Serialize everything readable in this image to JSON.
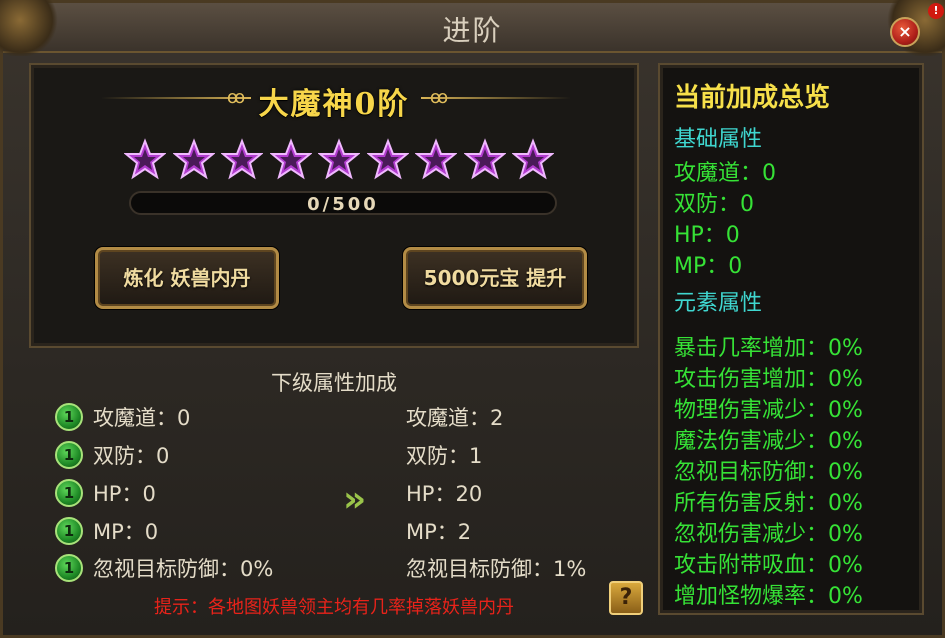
{
  "window": {
    "title": "进阶",
    "close_label": "×",
    "notif_badge": "!"
  },
  "rank": {
    "title": "大魔神0阶",
    "stars_total": 9,
    "stars_filled": 0,
    "progress_text": "0/500",
    "progress_fraction": 0
  },
  "buttons": {
    "refine": "炼化 妖兽内丹",
    "upgrade": "5000元宝 提升"
  },
  "next_level": {
    "title": "下级属性加成",
    "badge_label": "1",
    "current": [
      "攻魔道：0",
      "双防：0",
      "HP：0",
      "MP：0",
      "忽视目标防御：0%"
    ],
    "next": [
      "攻魔道：2",
      "双防：1",
      "HP：20",
      "MP：2",
      "忽视目标防御：1%"
    ],
    "arrow": "»"
  },
  "hint": "提示：各地图妖兽领主均有几率掉落妖兽内丹",
  "help_label": "?",
  "summary": {
    "title": "当前加成总览",
    "base_title": "基础属性",
    "base": [
      "攻魔道：0",
      "双防：0",
      "HP：0",
      "MP：0"
    ],
    "element_title": "元素属性",
    "element": [
      "暴击几率增加：0%",
      "攻击伤害增加：0%",
      "物理伤害减少：0%",
      "魔法伤害减少：0%",
      "忽视目标防御：0%",
      "所有伤害反射：0%",
      "忽视伤害减少：0%",
      "攻击附带吸血：0%",
      "增加怪物爆率：0%"
    ]
  },
  "colors": {
    "gold": "#f7d64a",
    "green": "#36e236",
    "cyan": "#3fd7d0",
    "red": "#e8231a",
    "star": "#b23ccf"
  }
}
